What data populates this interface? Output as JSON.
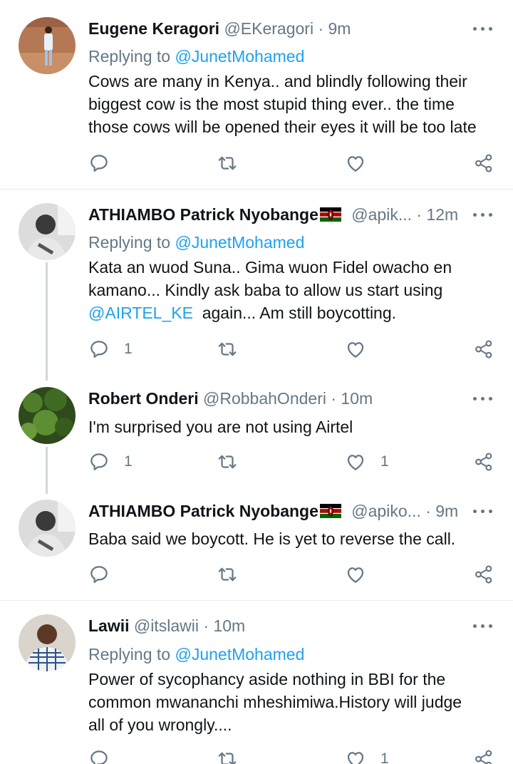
{
  "tweets": [
    {
      "name": "Eugene Keragori",
      "handle": "@EKeragori",
      "time": "9m",
      "replying_prefix": "Replying to",
      "replying_to": "@JunetMohamed",
      "text_lines": [
        "Cows are many in Kenya.. and blindly following their",
        "biggest cow is the most stupid thing ever.. the time",
        "those cows will be opened their eyes it will be too late"
      ],
      "reply_count": "",
      "retweet_count": "",
      "like_count": ""
    },
    {
      "name": "ATHIAMBO Patrick Nyobange",
      "handle": "@apik...",
      "time": "12m",
      "replying_prefix": "Replying to",
      "replying_to": "@JunetMohamed",
      "text_line1": "Kata an wuod Suna.. Gima wuon Fidel owacho en",
      "text_line2": "kamano... Kindly ask baba to allow us start using",
      "text_mention": "@AIRTEL_KE",
      "text_line3_rest": "  again... Am still boycotting.",
      "reply_count": "1",
      "retweet_count": "",
      "like_count": ""
    },
    {
      "name": "Robert Onderi",
      "handle": "@RobbahOnderi",
      "time": "10m",
      "text": "I'm surprised you are not using Airtel",
      "reply_count": "1",
      "retweet_count": "",
      "like_count": "1"
    },
    {
      "name": "ATHIAMBO Patrick Nyobange",
      "handle": "@apiko...",
      "time": "9m",
      "text": "Baba said we boycott. He is yet to reverse the call.",
      "reply_count": "",
      "retweet_count": "",
      "like_count": ""
    },
    {
      "name": "Lawii",
      "handle": "@itslawii",
      "time": "10m",
      "replying_prefix": "Replying to",
      "replying_to": "@JunetMohamed",
      "text_lines": [
        "Power of sycophancy aside nothing in BBI for the",
        "common mwananchi mheshimiwa.History will judge",
        "all of you wrongly...."
      ],
      "reply_count": "",
      "retweet_count": "",
      "like_count": "1"
    }
  ],
  "separator": "·",
  "colors": {
    "link": "#1da1f2",
    "secondary": "#657786",
    "text": "#0f1419",
    "divider": "#e6ecf0",
    "thread_line": "#cfd9de"
  },
  "icons": [
    "reply-icon",
    "retweet-icon",
    "like-icon",
    "share-icon",
    "more-icon",
    "kenya-flag-icon"
  ]
}
